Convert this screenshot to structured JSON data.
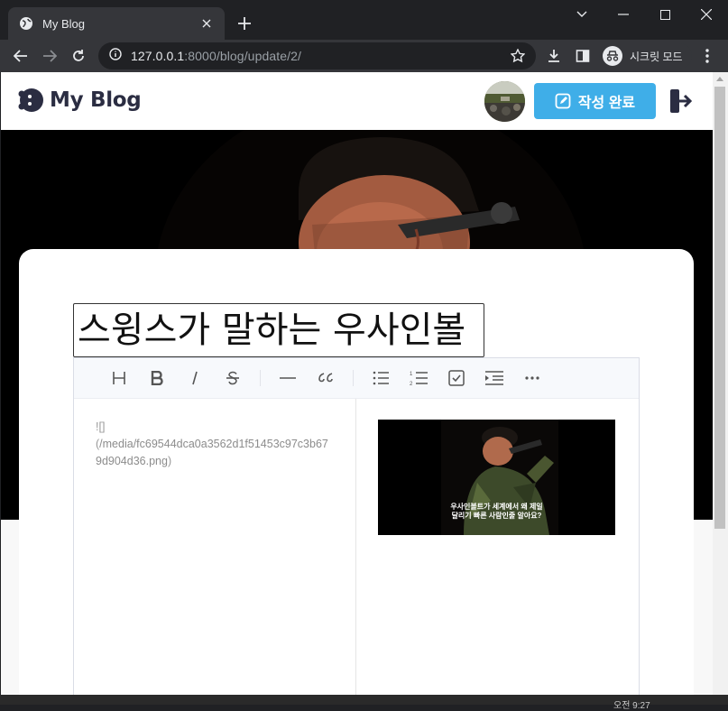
{
  "browser": {
    "tab_title": "My Blog",
    "url_host": "127.0.0.1",
    "url_rest": ":8000/blog/update/2/",
    "incognito_label": "시크릿 모드"
  },
  "site": {
    "logo_text": "My Blog",
    "done_button_label": "작성 완료"
  },
  "post": {
    "title_value": "스윙스가 말하는 우사인볼",
    "markdown_line1": "![]",
    "markdown_line2_open": "(",
    "markdown_url": "/media/fc69544dca0a3562d1f51453c97c3b679d904d36.png",
    "markdown_line2_close": ")",
    "preview_caption_line1": "우사인볼트가 세계에서 왜 제일",
    "preview_caption_line2": "달리기 빠른 사람인줄 알아요?"
  },
  "editor_toolbar": [
    "heading-icon",
    "bold-icon",
    "italic-icon",
    "strike-icon",
    "hr-icon",
    "quote-icon",
    "bullet-list-icon",
    "ordered-list-icon",
    "task-list-icon",
    "indent-icon",
    "more-icon"
  ],
  "taskbar": {
    "time": "오전 9:27"
  },
  "colors": {
    "accent": "#3faee8",
    "chrome_dark": "#202124",
    "chrome_toolbar": "#35363a"
  }
}
